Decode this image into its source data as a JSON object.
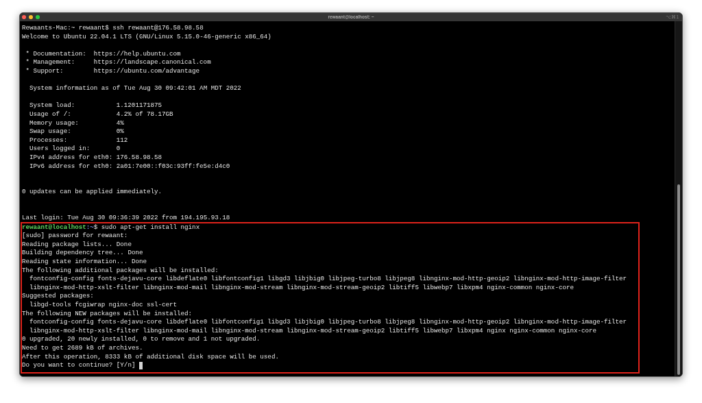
{
  "window": {
    "title": "rewaant@localhost: ~",
    "shortcut": "⌥⌘1"
  },
  "terminal": {
    "local_command": "Rewaants-Mac:~ rewaant$ ssh rewaant@176.58.98.58",
    "welcome": "Welcome to Ubuntu 22.04.1 LTS (GNU/Linux 5.15.0-46-generic x86_64)",
    "links": [
      {
        "label": "* Documentation:",
        "url": "https://help.ubuntu.com"
      },
      {
        "label": "* Management:",
        "url": "https://landscape.canonical.com"
      },
      {
        "label": "* Support:",
        "url": "https://ubuntu.com/advantage"
      }
    ],
    "system_info": {
      "heading": "System information as of Tue Aug 30 09:42:01 AM MDT 2022",
      "rows": [
        {
          "label": "System load:",
          "value": "1.1201171875"
        },
        {
          "label": "Usage of /:",
          "value": "4.2% of 78.17GB"
        },
        {
          "label": "Memory usage:",
          "value": "4%"
        },
        {
          "label": "Swap usage:",
          "value": "0%"
        },
        {
          "label": "Processes:",
          "value": "112"
        },
        {
          "label": "Users logged in:",
          "value": "0"
        },
        {
          "label": "IPv4 address for eth0:",
          "value": "176.58.98.58"
        },
        {
          "label": "IPv6 address for eth0:",
          "value": "2a01:7e00::f03c:93ff:fe5e:d4c0"
        }
      ]
    },
    "updates": "0 updates can be applied immediately.",
    "last_login": "Last login: Tue Aug 30 09:36:39 2022 from 194.195.93.18",
    "install": {
      "highlighted": true,
      "cursor": true,
      "prompt": {
        "user_host": "rewaant@localhost",
        "path": ":~",
        "command": "$ sudo apt-get install nginx"
      },
      "output": [
        {
          "kind": "plain",
          "text": "[sudo] password for rewaant:"
        },
        {
          "kind": "plain",
          "text": "Reading package lists... Done"
        },
        {
          "kind": "plain",
          "text": "Building dependency tree... Done"
        },
        {
          "kind": "plain",
          "text": "Reading state information... Done"
        },
        {
          "kind": "plain",
          "text": "The following additional packages will be installed:"
        },
        {
          "kind": "indented",
          "text": "fontconfig-config fonts-dejavu-core libdeflate0 libfontconfig1 libgd3 libjbig0 libjpeg-turbo8 libjpeg8 libnginx-mod-http-geoip2 libnginx-mod-http-image-filter"
        },
        {
          "kind": "indented",
          "text": "libnginx-mod-http-xslt-filter libnginx-mod-mail libnginx-mod-stream libnginx-mod-stream-geoip2 libtiff5 libwebp7 libxpm4 nginx-common nginx-core"
        },
        {
          "kind": "plain",
          "text": "Suggested packages:"
        },
        {
          "kind": "indented",
          "text": "libgd-tools fcgiwrap nginx-doc ssl-cert"
        },
        {
          "kind": "plain",
          "text": "The following NEW packages will be installed:"
        },
        {
          "kind": "indented",
          "text": "fontconfig-config fonts-dejavu-core libdeflate0 libfontconfig1 libgd3 libjbig0 libjpeg-turbo8 libjpeg8 libnginx-mod-http-geoip2 libnginx-mod-http-image-filter"
        },
        {
          "kind": "indented",
          "text": "libnginx-mod-http-xslt-filter libnginx-mod-mail libnginx-mod-stream libnginx-mod-stream-geoip2 libtiff5 libwebp7 libxpm4 nginx nginx-common nginx-core"
        },
        {
          "kind": "plain",
          "text": "0 upgraded, 20 newly installed, 0 to remove and 1 not upgraded."
        },
        {
          "kind": "plain",
          "text": "Need to get 2689 kB of archives."
        },
        {
          "kind": "plain",
          "text": "After this operation, 8333 kB of additional disk space will be used."
        },
        {
          "kind": "plain",
          "text": "Do you want to continue? [Y/n]"
        }
      ]
    }
  }
}
